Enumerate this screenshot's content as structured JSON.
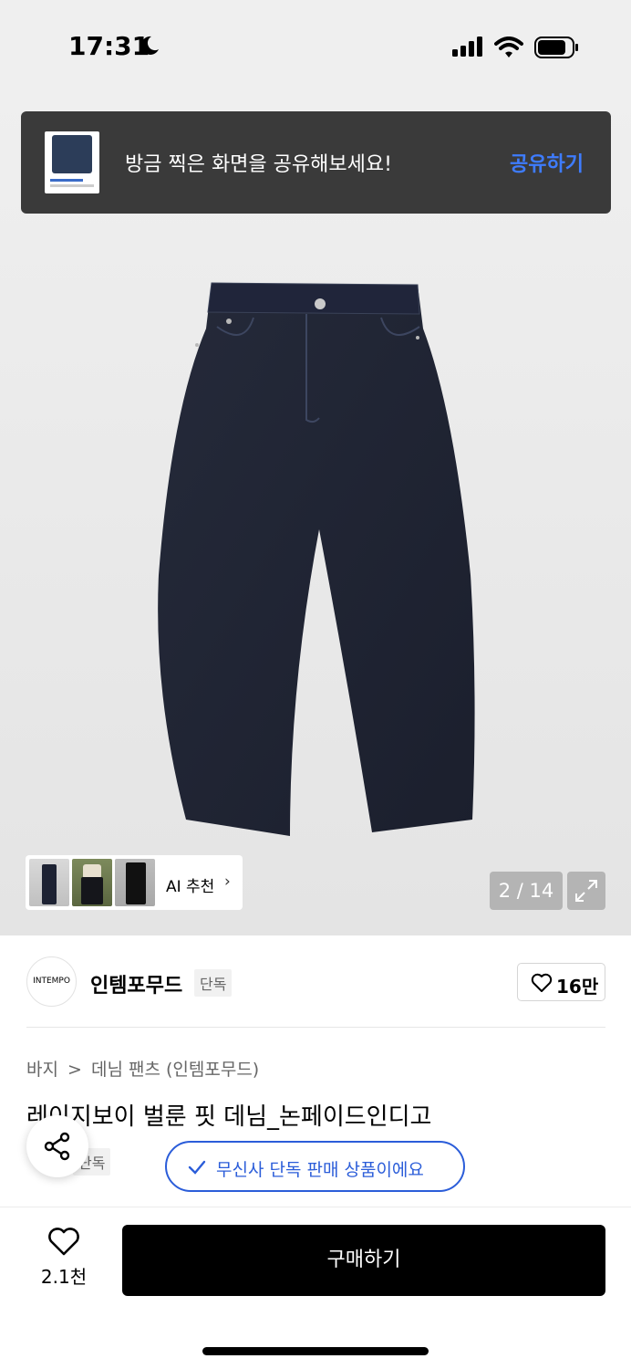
{
  "status_bar": {
    "time": "17:31"
  },
  "toast": {
    "message": "방금 찍은 화면을 공유해보세요!",
    "action_label": "공유하기"
  },
  "gallery": {
    "ai_label": "AI 추천",
    "page_counter": "2 / 14"
  },
  "brand": {
    "logo_text": "INTEMPO",
    "name": "인템포무드",
    "badge": "단독",
    "like_count": "16만"
  },
  "breadcrumb": {
    "category": "바지",
    "separator": ">",
    "subcategory": "데님 팬츠 (인템포무드)"
  },
  "product": {
    "title": "레이지보이 벌룬 핏 데님_논페이드인디고",
    "tag_badge": "단독",
    "exclusive_notice": "무신사 단독 판매 상품이에요"
  },
  "bottom_bar": {
    "wish_count": "2.1천",
    "buy_label": "구매하기"
  },
  "colors": {
    "accent_blue": "#2b5dd9",
    "toast_bg": "#3a3a3a",
    "buy_bg": "#000000"
  }
}
